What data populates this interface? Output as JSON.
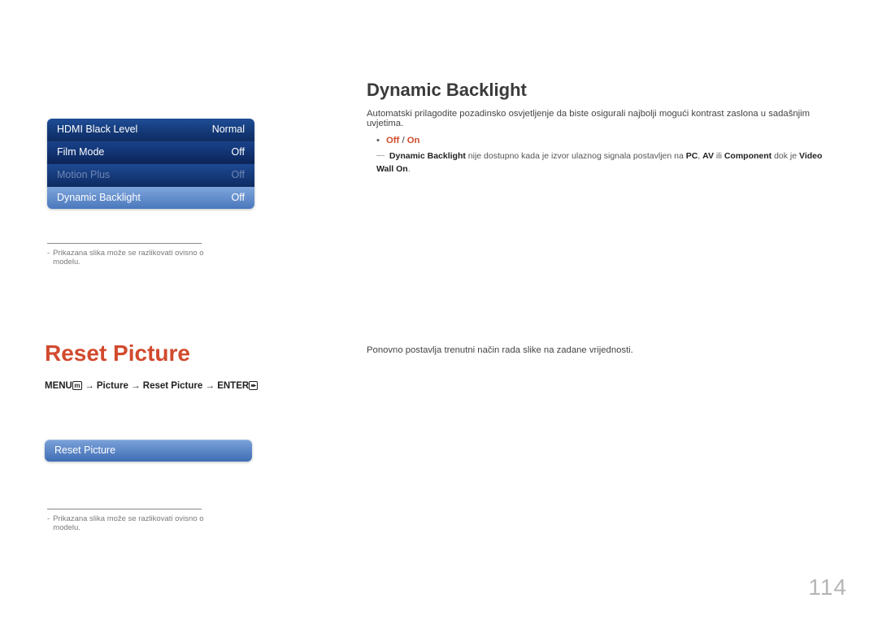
{
  "menu_panel1": {
    "rows": [
      {
        "label": "HDMI Black Level",
        "value": "Normal"
      },
      {
        "label": "Film Mode",
        "value": "Off"
      },
      {
        "label": "Motion Plus",
        "value": "Off"
      },
      {
        "label": "Dynamic Backlight",
        "value": "Off"
      }
    ]
  },
  "footnote1": "Prikazana slika može se razlikovati ovisno o modelu.",
  "dynamic_backlight": {
    "title": "Dynamic Backlight",
    "desc": "Automatski prilagodite pozadinsko osvjetljenje da biste osigurali najbolji mogući kontrast zaslona u sadašnjim uvjetima.",
    "off": "Off",
    "on": "On",
    "note_pre": "Dynamic Backlight",
    "note_mid1": " nije dostupno kada je izvor ulaznog signala postavljen na ",
    "note_pc": "PC",
    "note_sep1": ", ",
    "note_av": "AV",
    "note_mid2": " ili ",
    "note_comp": "Component",
    "note_mid3": " dok je ",
    "note_vw": "Video Wall",
    "note_space": " ",
    "note_on": "On",
    "note_end": "."
  },
  "reset": {
    "title": "Reset Picture",
    "bc_menu": "MENU",
    "bc_arrow": " → ",
    "bc_picture": "Picture",
    "bc_reset": "Reset Picture",
    "bc_enter": "ENTER",
    "desc": "Ponovno postavlja trenutni način rada slike na zadane vrijednosti."
  },
  "menu_panel2": {
    "label": "Reset Picture"
  },
  "footnote2": "Prikazana slika može se razlikovati ovisno o modelu.",
  "page_number": "114"
}
